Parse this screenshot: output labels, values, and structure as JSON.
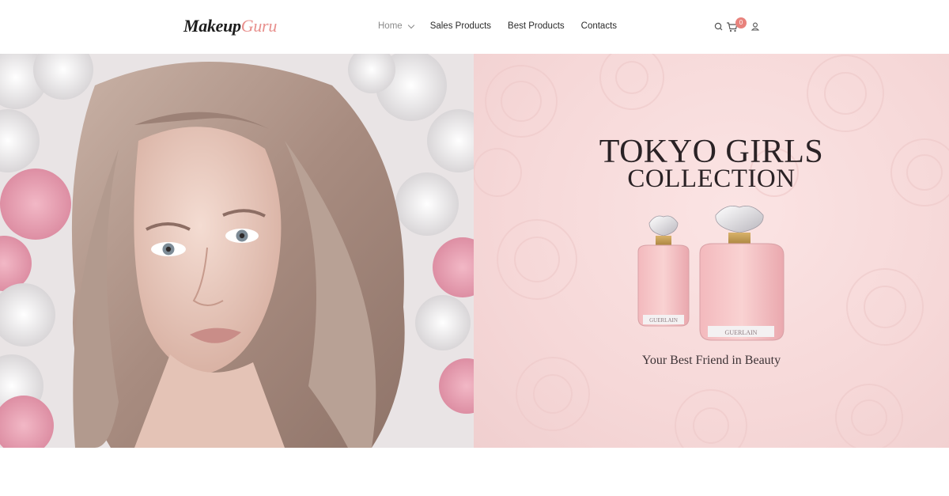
{
  "brand": {
    "logo_part1": "Makeup",
    "logo_part2": "Guru"
  },
  "nav": {
    "items": [
      {
        "label": "Home",
        "active": true,
        "has_dropdown": true
      },
      {
        "label": "Sales Products",
        "active": false
      },
      {
        "label": "Best Products",
        "active": false
      },
      {
        "label": "Contacts",
        "active": false
      }
    ]
  },
  "tools": {
    "search_icon": "search-icon",
    "cart_icon": "cart-icon",
    "cart_count": "0",
    "account_icon": "user-icon"
  },
  "hero": {
    "title_line1": "TOKYO GIRLS",
    "title_line2": "COLLECTION",
    "tagline": "Your Best Friend in Beauty",
    "bottle_label": "GUERLAIN"
  },
  "colors": {
    "accent": "#e8908d",
    "badge": "#e8827c",
    "hero_bg": "#f6d8d8",
    "text_dark": "#2a2225"
  }
}
